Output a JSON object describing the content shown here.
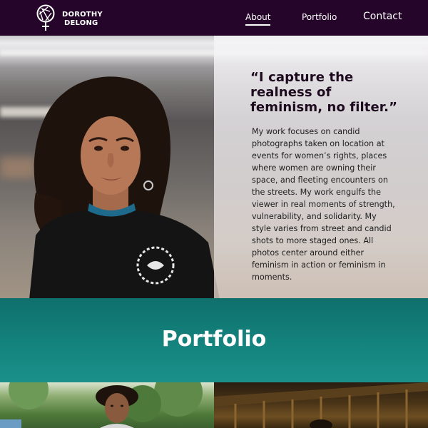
{
  "brand": {
    "name_line1": "DOROTHY",
    "name_line2": "DELONG",
    "logo_icon": "camera-aperture-venus-icon"
  },
  "nav": {
    "items": [
      {
        "label": "About",
        "active": true
      },
      {
        "label": "Portfolio",
        "active": false
      },
      {
        "label": "Contact",
        "active": false
      }
    ]
  },
  "hero": {
    "quote": "“I capture the realness of feminism, no filter.”",
    "bio": "My work focuses on candid photographs taken on location at events for women’s rights, places where women are owning their space, and fleeting encounters on the streets. My work engulfs the viewer in real moments of strength, vulnerability, and solidarity. My style varies from street and candid shots to more staged ones. All photos center around either feminism in action or feminism in moments."
  },
  "portfolio": {
    "heading": "Portfolio"
  },
  "colors": {
    "nav_bg": "#25052a",
    "band_teal": "#15857f",
    "quote_text": "#1d0a1f"
  }
}
